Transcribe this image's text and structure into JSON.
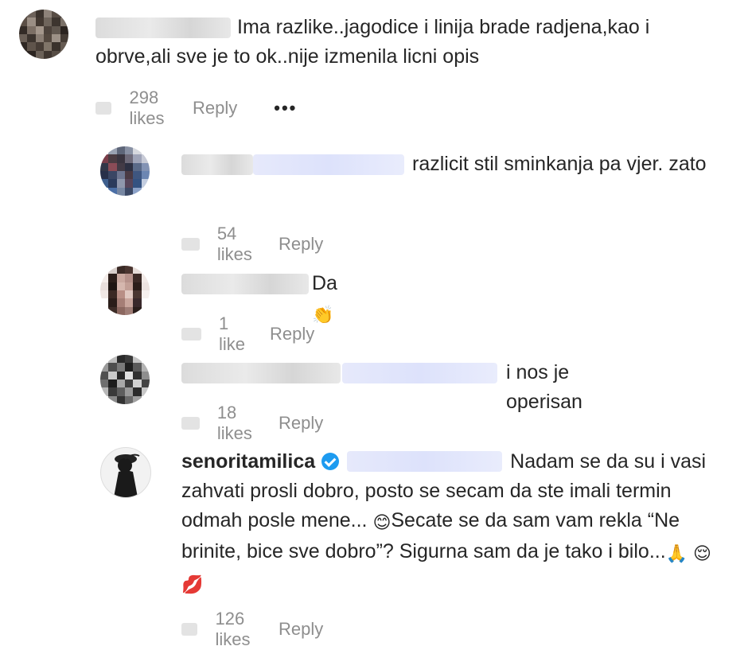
{
  "comments": [
    {
      "text": "Ima razlike..jagodice i linija brade radjena,kao i obrve,ali sve je to ok..nije izmenila licni opis",
      "likes": "298 likes",
      "reply": "Reply",
      "more": "•••"
    },
    {
      "text": "razlicit stil sminkanja pa vjer. zato",
      "likes": "54 likes",
      "reply": "Reply"
    },
    {
      "text": "Da",
      "emoji": "👏",
      "likes": "1 like",
      "reply": "Reply"
    },
    {
      "text": "i nos je operisan",
      "likes": "18 likes",
      "reply": "Reply"
    },
    {
      "username": "senoritamilica",
      "text_part1": "Nadam se da su i vasi zahvati prosli dobro, posto se secam da ste imali termin odmah posle mene...",
      "emoji1": "😊",
      "text_part2": "Secate se da sam vam rekla “Ne brinite, bice sve dobro”? Sigurna sam da je tako i bilo...",
      "emoji2": "🙏",
      "emoji3": "😌",
      "emoji4": "💋",
      "likes": "126 likes",
      "reply": "Reply"
    }
  ]
}
